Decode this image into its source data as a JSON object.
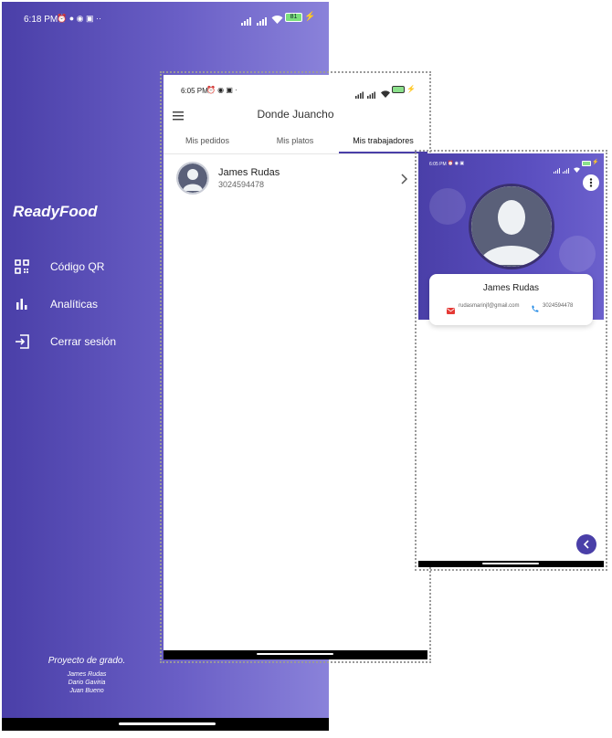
{
  "phone1": {
    "status_time": "6:18 PM",
    "battery": "81",
    "app_title": "ReadyFood",
    "menu": [
      {
        "label": "Código QR",
        "icon": "qr-code-icon"
      },
      {
        "label": "Analíticas",
        "icon": "bar-chart-icon"
      },
      {
        "label": "Cerrar sesión",
        "icon": "logout-icon"
      }
    ],
    "credits": {
      "heading": "Proyecto de grado.",
      "authors": [
        "James Rudas",
        "Dario Gaviria",
        "Juan Bueno"
      ]
    }
  },
  "phone2": {
    "status_time": "6:05 PM",
    "header_title": "Donde Juancho",
    "tabs": [
      {
        "label": "Mis pedidos",
        "active": false
      },
      {
        "label": "Mis platos",
        "active": false
      },
      {
        "label": "Mis trabajadores",
        "active": true
      }
    ],
    "workers": [
      {
        "name": "James Rudas",
        "phone": "3024594478"
      }
    ]
  },
  "phone3": {
    "status_time": "6:05 PM",
    "profile": {
      "name": "James Rudas",
      "email": "rudasmarinjf@gmail.com",
      "phone": "3024594478"
    }
  },
  "colors": {
    "primary": "#4a3fa8",
    "primary_light": "#8a82da",
    "email_icon": "#e53935",
    "phone_icon": "#1e88e5"
  }
}
